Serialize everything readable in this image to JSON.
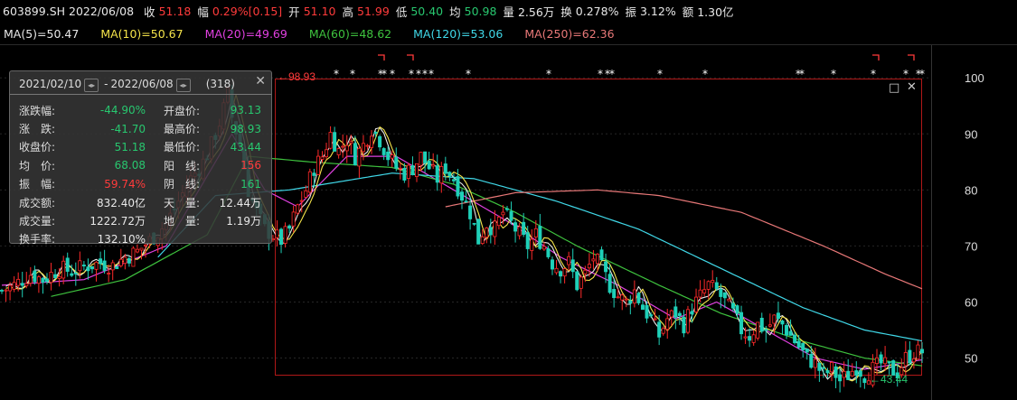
{
  "header": {
    "symbol_date": "603899.SH 2022/06/08",
    "close_label": "收",
    "close": "51.18",
    "change_label": "幅",
    "change": "0.29%[0.15]",
    "open_label": "开",
    "open": "51.10",
    "high_label": "高",
    "high": "51.99",
    "low_label": "低",
    "low": "50.40",
    "avg_label": "均",
    "avg": "50.98",
    "vol_label": "量",
    "vol": "2.56万",
    "turnover_label": "换",
    "turnover": "0.278%",
    "amp_label": "振",
    "amp": "3.12%",
    "amount_label": "额",
    "amount": "1.30亿"
  },
  "ma_legend": [
    {
      "label": "MA(5)=50.47",
      "color": "#e8e8e8"
    },
    {
      "label": "MA(10)=50.67",
      "color": "#f5e44a"
    },
    {
      "label": "MA(20)=49.69",
      "color": "#e040e0"
    },
    {
      "label": "MA(60)=48.62",
      "color": "#3ec23e"
    },
    {
      "label": "MA(120)=53.06",
      "color": "#40d8e8"
    },
    {
      "label": "MA(250)=62.36",
      "color": "#e87878"
    }
  ],
  "stats_box": {
    "range_start": "2021/02/10",
    "range_end": "2022/06/08",
    "count": "(318)",
    "rows": [
      {
        "l1": "涨跌幅:",
        "v1": "-44.90%",
        "c1": "#28c76f",
        "l2": "开盘价:",
        "v2": "93.13",
        "c2": "#28c76f"
      },
      {
        "l1": "涨　跌:",
        "v1": "-41.70",
        "c1": "#28c76f",
        "l2": "最高价:",
        "v2": "98.93",
        "c2": "#28c76f"
      },
      {
        "l1": "收盘价:",
        "v1": "51.18",
        "c1": "#28c76f",
        "l2": "最低价:",
        "v2": "43.44",
        "c2": "#28c76f"
      },
      {
        "l1": "均　价:",
        "v1": "68.08",
        "c1": "#28c76f",
        "l2": "阳　线:",
        "v2": "156",
        "c2": "#ff3b3b"
      },
      {
        "l1": "振　幅:",
        "v1": "59.74%",
        "c1": "#ff3b3b",
        "l2": "阴　线:",
        "v2": "161",
        "c2": "#28c76f"
      },
      {
        "l1": "成交额:",
        "v1": "832.40亿",
        "c1": "#e8e8e8",
        "l2": "天　量:",
        "v2": "12.44万",
        "c2": "#e8e8e8"
      },
      {
        "l1": "成交量:",
        "v1": "1222.72万",
        "c1": "#e8e8e8",
        "l2": "地　量:",
        "v2": "1.19万",
        "c2": "#e8e8e8"
      },
      {
        "l1": "换手率:",
        "v1": "132.10%",
        "c1": "#e8e8e8",
        "l2": "",
        "v2": "",
        "c2": "#e8e8e8"
      }
    ]
  },
  "chart_data": {
    "type": "candlestick",
    "y_ticks": [
      "100",
      "90",
      "80",
      "70",
      "60",
      "50"
    ],
    "ylim": [
      43,
      101
    ],
    "period_high_marker": "←98.93",
    "period_low_marker": "←43.44",
    "close_path": [
      [
        0,
        62
      ],
      [
        3,
        63
      ],
      [
        7,
        65
      ],
      [
        10,
        64
      ],
      [
        14,
        66
      ],
      [
        17,
        65.5
      ],
      [
        21,
        66.5
      ],
      [
        24,
        67
      ],
      [
        27,
        66.5
      ],
      [
        30,
        68
      ],
      [
        33,
        69
      ],
      [
        36,
        71
      ],
      [
        40,
        74
      ],
      [
        43,
        78
      ],
      [
        46,
        82
      ],
      [
        49,
        85
      ],
      [
        51,
        88
      ],
      [
        53,
        92
      ],
      [
        55,
        97
      ],
      [
        56,
        93
      ],
      [
        58,
        88
      ],
      [
        60,
        80
      ],
      [
        62,
        76
      ],
      [
        64,
        73
      ],
      [
        66,
        72
      ],
      [
        68,
        71
      ],
      [
        70,
        73
      ],
      [
        72,
        77
      ],
      [
        74,
        80
      ],
      [
        76,
        84
      ],
      [
        78,
        86
      ],
      [
        80,
        90
      ],
      [
        82,
        87
      ],
      [
        84,
        89
      ],
      [
        86,
        86
      ],
      [
        88,
        88
      ],
      [
        90,
        91
      ],
      [
        92,
        89
      ],
      [
        94,
        86
      ],
      [
        96,
        84
      ],
      [
        98,
        83
      ],
      [
        100,
        84
      ],
      [
        102,
        86
      ],
      [
        104,
        84
      ],
      [
        106,
        82
      ],
      [
        108,
        84
      ],
      [
        110,
        82
      ],
      [
        112,
        79
      ],
      [
        114,
        76
      ],
      [
        116,
        71
      ],
      [
        118,
        74
      ],
      [
        120,
        73
      ],
      [
        122,
        76
      ],
      [
        124,
        74
      ],
      [
        126,
        72
      ],
      [
        128,
        70
      ],
      [
        130,
        72
      ],
      [
        132,
        70
      ],
      [
        134,
        67
      ],
      [
        136,
        66
      ],
      [
        138,
        67
      ],
      [
        140,
        63
      ],
      [
        142,
        65
      ],
      [
        144,
        68
      ],
      [
        146,
        66
      ],
      [
        148,
        63
      ],
      [
        150,
        61
      ],
      [
        152,
        60
      ],
      [
        154,
        62
      ],
      [
        156,
        59
      ],
      [
        158,
        57
      ],
      [
        160,
        54
      ],
      [
        162,
        57
      ],
      [
        164,
        58
      ],
      [
        166,
        56
      ],
      [
        168,
        59
      ],
      [
        170,
        61
      ],
      [
        172,
        63
      ],
      [
        174,
        62
      ],
      [
        176,
        60
      ],
      [
        178,
        58
      ],
      [
        180,
        55
      ],
      [
        182,
        54
      ],
      [
        184,
        56
      ],
      [
        186,
        55
      ],
      [
        188,
        57
      ],
      [
        190,
        56
      ],
      [
        192,
        54
      ],
      [
        194,
        52
      ],
      [
        196,
        50
      ],
      [
        198,
        49
      ],
      [
        200,
        47
      ],
      [
        202,
        48
      ],
      [
        204,
        46
      ],
      [
        206,
        47
      ],
      [
        208,
        48.5
      ],
      [
        210,
        47
      ],
      [
        212,
        48
      ],
      [
        214,
        49
      ],
      [
        216,
        48
      ],
      [
        218,
        47.5
      ],
      [
        220,
        50
      ],
      [
        222,
        51
      ],
      [
        224,
        51.18
      ]
    ],
    "ma_series": [
      {
        "name": "MA(20)",
        "path": [
          [
            0,
            63
          ],
          [
            20,
            64
          ],
          [
            40,
            70
          ],
          [
            56,
            90
          ],
          [
            64,
            80
          ],
          [
            72,
            77
          ],
          [
            84,
            86
          ],
          [
            96,
            86
          ],
          [
            110,
            80
          ],
          [
            124,
            74
          ],
          [
            136,
            68
          ],
          [
            150,
            63
          ],
          [
            164,
            57
          ],
          [
            174,
            60
          ],
          [
            186,
            55
          ],
          [
            198,
            50
          ],
          [
            210,
            48
          ],
          [
            224,
            49.69
          ]
        ]
      },
      {
        "name": "MA(60)",
        "path": [
          [
            12,
            61
          ],
          [
            30,
            64
          ],
          [
            50,
            72
          ],
          [
            60,
            86
          ],
          [
            75,
            85
          ],
          [
            95,
            84
          ],
          [
            110,
            81
          ],
          [
            125,
            76
          ],
          [
            140,
            70
          ],
          [
            160,
            63
          ],
          [
            175,
            58
          ],
          [
            195,
            53
          ],
          [
            210,
            50
          ],
          [
            224,
            48.62
          ]
        ]
      },
      {
        "name": "MA(120)",
        "path": [
          [
            38,
            68
          ],
          [
            52,
            79
          ],
          [
            70,
            80
          ],
          [
            95,
            83
          ],
          [
            115,
            82
          ],
          [
            135,
            78
          ],
          [
            155,
            73
          ],
          [
            175,
            66
          ],
          [
            195,
            59
          ],
          [
            210,
            55
          ],
          [
            224,
            53.06
          ]
        ]
      },
      {
        "name": "MA(250)",
        "path": [
          [
            108,
            77
          ],
          [
            125,
            79.5
          ],
          [
            145,
            80
          ],
          [
            160,
            79
          ],
          [
            180,
            76
          ],
          [
            200,
            70
          ],
          [
            215,
            65
          ],
          [
            224,
            62.36
          ]
        ]
      }
    ]
  }
}
